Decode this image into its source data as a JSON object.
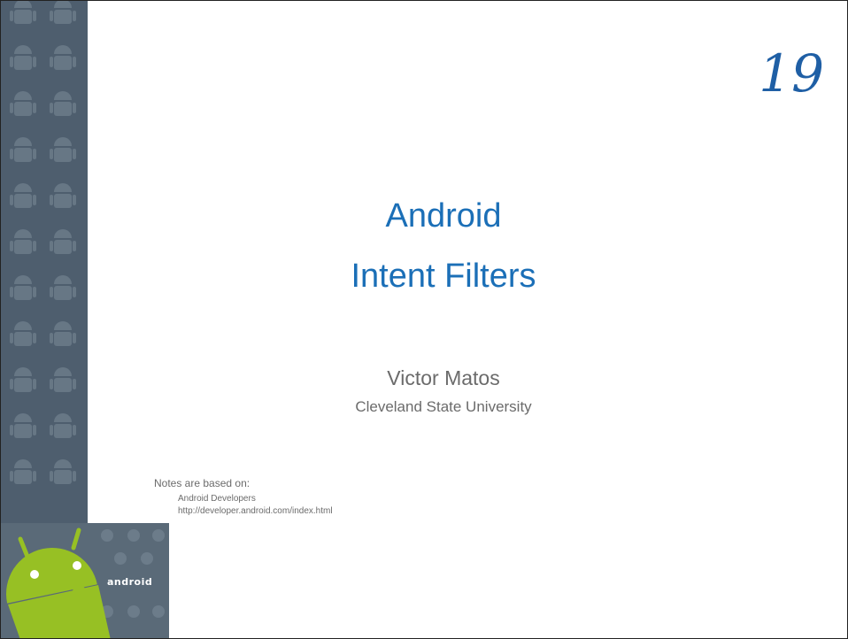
{
  "slide": {
    "number": "19",
    "title_line1": "Android",
    "title_line2": "Intent Filters",
    "author": "Victor Matos",
    "affiliation": "Cleveland State University",
    "notes_label": "Notes are based on:",
    "notes_source": "Android Developers",
    "notes_url": "http://developer.android.com/index.html",
    "logo_text": "android",
    "colors": {
      "title": "#1b6fb7",
      "number": "#1f5fa5",
      "strip": "#4e5e6e",
      "android_green": "#97c024",
      "text_gray": "#6b6b6b"
    }
  }
}
